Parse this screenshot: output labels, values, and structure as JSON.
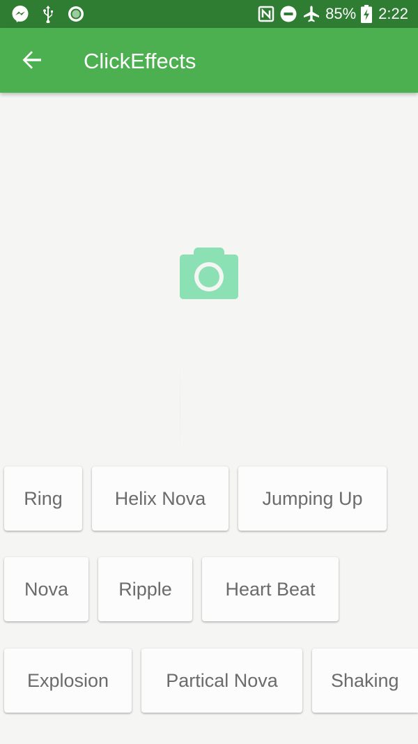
{
  "status_bar": {
    "battery_percent": "85%",
    "time": "2:22",
    "icons": [
      "messenger-icon",
      "usb-icon",
      "record-icon",
      "nfc-icon",
      "do-not-disturb-icon",
      "airplane-mode-icon",
      "battery-charging-icon"
    ]
  },
  "app_bar": {
    "title": "ClickEffects",
    "back_icon": "arrow-back-icon"
  },
  "main": {
    "camera_icon": "camera-icon",
    "effect_buttons": [
      "Ring",
      "Helix Nova",
      "Jumping Up",
      "Nova",
      "Ripple",
      "Heart Beat",
      "Explosion",
      "Partical Nova",
      "Shaking"
    ]
  },
  "colors": {
    "status_bar": "#2e7d32",
    "app_bar": "#4caf50",
    "camera_icon": "#8be0b4",
    "background": "#f5f6f4",
    "button_text": "#6b6b6b"
  }
}
